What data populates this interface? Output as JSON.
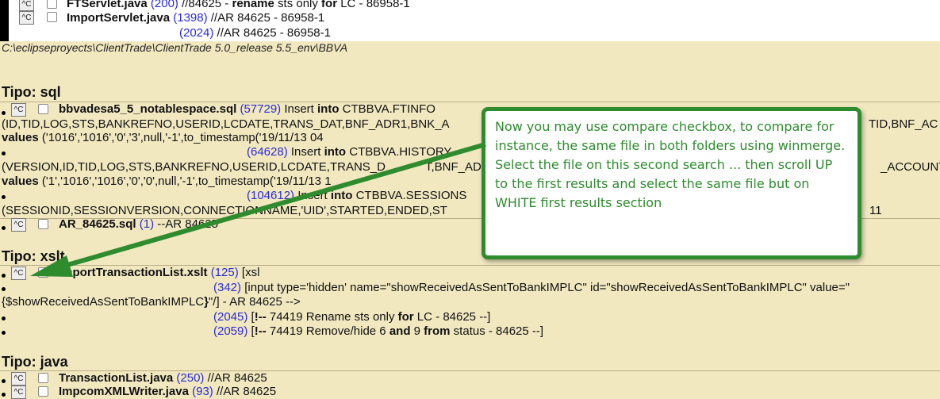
{
  "compare_button_label": "^C",
  "top_section": {
    "rows": [
      {
        "filename": "FTServlet.java",
        "match_no": "(200)",
        "text_pre": "//84625 - ",
        "text_bold": "rename",
        "text_mid": " sts only ",
        "text_bold2": "for",
        "text_post": " LC - 86958-1"
      },
      {
        "filename": "ImportServlet.java",
        "match_no": "(1398)",
        "text": "//AR 84625 - 86958-1"
      },
      {
        "match_no": "(2024)",
        "text": "//AR 84625 - 86958-1"
      }
    ]
  },
  "path": "C:\\eclipseproyects\\ClientTrade\\ClientTrade 5.0_release 5.5_env\\BBVA",
  "sections": {
    "sql": {
      "heading": "Tipo: sql",
      "file1": {
        "filename": "bbvadesa5_5_notablespace.sql",
        "match1": {
          "no": "(57729)",
          "pre": "Insert ",
          "kw": "into",
          "post": " CTBBVA.FTINFO"
        },
        "match1_line2": "(ID,TID,LOG,STS,BANKREFNO,USERID,LCDATE,TRANS_DAT,BNF_ADR1,BNK_A",
        "match1_line2_tail": "TID,BNF_AC",
        "match1_line3_kw": "values",
        "match1_line3": " ('1016','1016','0','3',null,'-1',to_timestamp('19/11/13 04",
        "match2": {
          "no": "(64628)",
          "pre": "Insert ",
          "kw": "into",
          "post": " CTBBVA.HISTORY"
        },
        "match2_line2": "(VERSION,ID,TID,LOG,STS,BANKREFNO,USERID,LCDATE,TRANS_D",
        "match2_line2_mid": "T,BNF_AD",
        "match2_line2_tail": "_ACCOUNT",
        "match2_line3_kw": "values",
        "match2_line3": " ('1','1016','1016','0','0',null,'-1',to_timestamp('19/11/13 1",
        "match3": {
          "no": "(104612)",
          "pre": " Insert ",
          "kw": "into",
          "post": " CTBBVA.SESSIONS"
        },
        "match3_line2": "(SESSIONID,SESSIONVERSION,CONNECTIONNAME,'UID',STARTED,ENDED,ST",
        "match3_line2_tail": "11"
      },
      "file2": {
        "filename": "AR_84625.sql",
        "match_no": "(1)",
        "text": "--AR 84625"
      }
    },
    "xslt": {
      "heading": "Tipo: xslt",
      "file1": {
        "filename": "ImportTransactionList.xslt",
        "match1": {
          "no": "(125)",
          "text": "[xsl"
        },
        "match2": {
          "no": "(342)",
          "text": "[input type='hidden' name=\"showReceivedAsSentToBankIMPLC\" id=\"showReceivedAsSentToBankIMPLC\" value=\""
        },
        "match2_cont_pre": "{$showReceivedAsSentToBankIMPLC",
        "match2_cont_bold": "}",
        "match2_cont_post": "\"/] - AR 84625 -->",
        "match3": {
          "no": "(2045)",
          "pre": "[",
          "bold": "!--",
          "mid": " 74419 Rename sts only ",
          "bold2": "for",
          "post": " LC - 84625 --]"
        },
        "match4": {
          "no": "(2059)",
          "pre": "[",
          "bold": "!--",
          "mid": " 74419 Remove/hide 6 ",
          "bold2": "and",
          "mid2": " 9 ",
          "bold3": "from",
          "post": " status - 84625 --]"
        }
      }
    },
    "java": {
      "heading": "Tipo: java",
      "file1": {
        "filename": "TransactionList.java",
        "match_no": "(250)",
        "text": "//AR 84625"
      },
      "file2": {
        "filename": "ImpcomXMLWriter.java",
        "match_no": "(93)",
        "text": "//AR 84625"
      }
    }
  },
  "callout": {
    "text": "Now you may use compare checkbox, to compare for instance, the same file in both folders using winmerge. Select the file on this second search ... then scroll UP to the first results and select the same file but on WHITE first results section",
    "color": "#2e8b2e"
  }
}
